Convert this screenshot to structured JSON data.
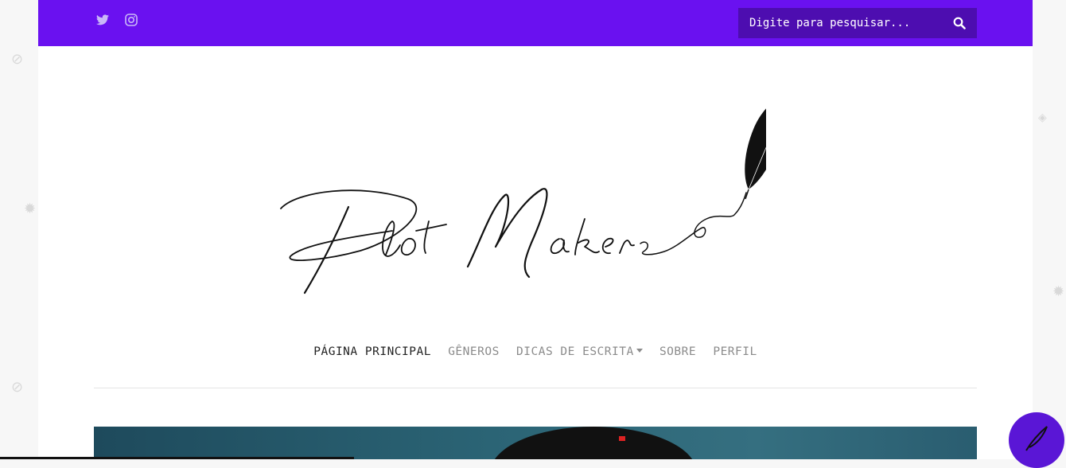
{
  "topbar": {
    "social": [
      {
        "name": "twitter-icon"
      },
      {
        "name": "instagram-icon"
      }
    ],
    "search": {
      "placeholder": "Digite para pesquisar...",
      "icon": "search-icon"
    }
  },
  "logo": {
    "text": "Plot Makers",
    "icon": "feather-icon"
  },
  "nav": {
    "items": [
      {
        "label": "PÁGINA PRINCIPAL",
        "active": true
      },
      {
        "label": "GÊNEROS"
      },
      {
        "label": "DICAS DE ESCRITA",
        "dropdown": true
      },
      {
        "label": "SOBRE"
      },
      {
        "label": "PERFIL"
      }
    ]
  },
  "fab": {
    "icon": "feather-icon"
  },
  "colors": {
    "brand": "#6a11f0",
    "search_bg": "#4d0db0",
    "fab": "#5a16d6",
    "nav_active": "#222222",
    "nav": "#8b8b8b"
  }
}
